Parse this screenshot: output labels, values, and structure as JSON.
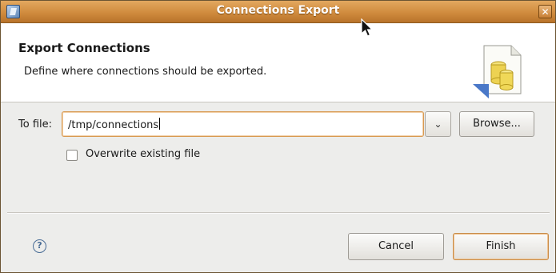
{
  "window": {
    "title": "Connections Export",
    "close_glyph": "✕"
  },
  "header": {
    "title": "Export Connections",
    "description": "Define where connections should be exported.",
    "image": "connections-database-icon"
  },
  "form": {
    "to_file_label": "To file:",
    "to_file_value": "/tmp/connections",
    "dropdown_glyph": "⌄",
    "browse_label": "Browse...",
    "overwrite_label": "Overwrite existing file",
    "overwrite_checked": false
  },
  "footer": {
    "help_glyph": "?",
    "cancel_label": "Cancel",
    "finish_label": "Finish"
  },
  "colors": {
    "titlebar": "#d08b3e",
    "focus_border": "#d89a52",
    "dialog_bg": "#ededeb"
  }
}
